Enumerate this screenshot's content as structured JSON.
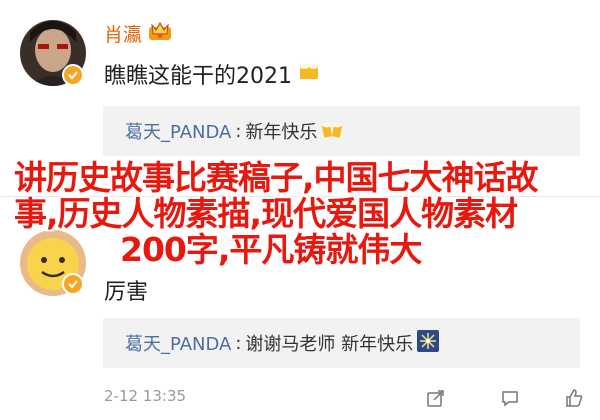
{
  "comments": [
    {
      "username": "肖瀛",
      "text": "瞧瞧这能干的2021",
      "emoji": "beer-icon",
      "reply": {
        "name": "葛天_PANDA",
        "text": "新年快乐",
        "emoji": "cheers-icon"
      }
    },
    {
      "text": "厉害",
      "reply": {
        "name": "葛天_PANDA",
        "text": "谢谢马老师 新年快乐",
        "emoji": "firework-icon"
      },
      "time": "2-12 13:35"
    }
  ],
  "overlay": {
    "line1": "讲历史故事比赛稿子,中国七大神话故",
    "line2": "事,历史人物素描,现代爱国人物素材",
    "line3": "200字,平凡铸就伟大"
  },
  "colors": {
    "username": "#e8640a",
    "reply_name": "#4a6fa5",
    "overlay_text": "#e8180f",
    "verified": "#f6a623",
    "meta": "#999999"
  }
}
